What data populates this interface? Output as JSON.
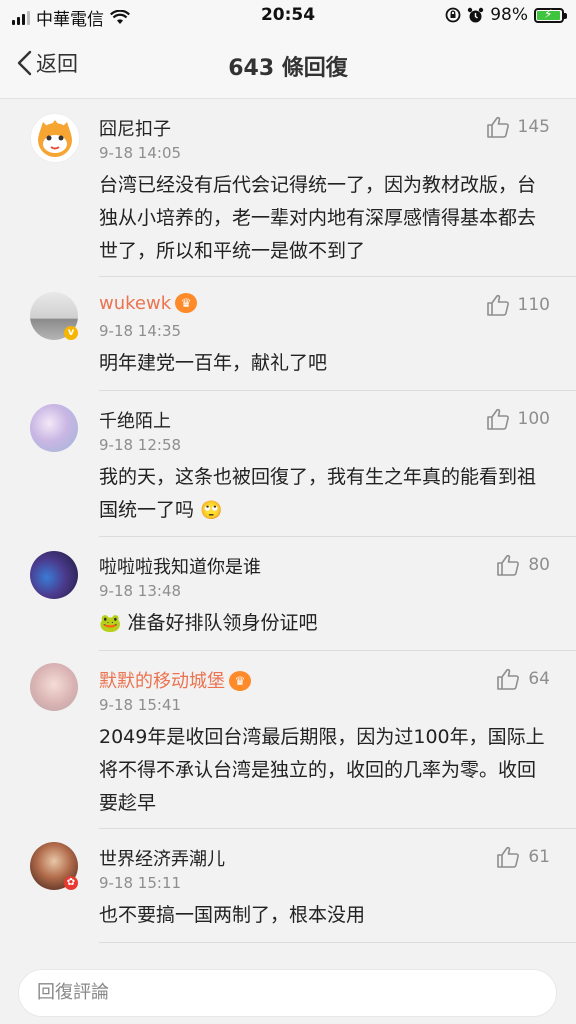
{
  "status": {
    "carrier": "中華電信",
    "time": "20:54",
    "battery_pct": "98%"
  },
  "nav": {
    "back_label": "返回",
    "title": "643 條回復"
  },
  "comments": [
    {
      "name": "囧尼扣子",
      "time": "9-18 14:05",
      "likes": "145",
      "text": "台湾已经没有后代会记得统一了，因为教材改版，台独从小培养的，老一辈对内地有深厚感情得基本都去世了，所以和平统一是做不到了"
    },
    {
      "name": "wukewk",
      "time": "9-18 14:35",
      "likes": "110",
      "text": "明年建党一百年，献礼了吧"
    },
    {
      "name": "千绝陌上",
      "time": "9-18 12:58",
      "likes": "100",
      "text": "我的天，这条也被回復了，我有生之年真的能看到祖国统一了吗"
    },
    {
      "name": "啦啦啦我知道你是谁",
      "time": "9-18 13:48",
      "likes": "80",
      "text": "准备好排队领身份证吧"
    },
    {
      "name": "默默的移动城堡",
      "time": "9-18 15:41",
      "likes": "64",
      "text": "2049年是收回台湾最后期限，因为过100年，国际上将不得不承认台湾是独立的，收回的几率为零。收回要趁早"
    },
    {
      "name": "世界经济弄潮儿",
      "time": "9-18 15:11",
      "likes": "61",
      "text": "也不要搞一国两制了，根本没用"
    }
  ],
  "input": {
    "placeholder": "回復評論"
  },
  "colors": {
    "vip_name": "#eb7350",
    "meta_gray": "#8e8e8e",
    "battery_green": "#3ec43e"
  }
}
